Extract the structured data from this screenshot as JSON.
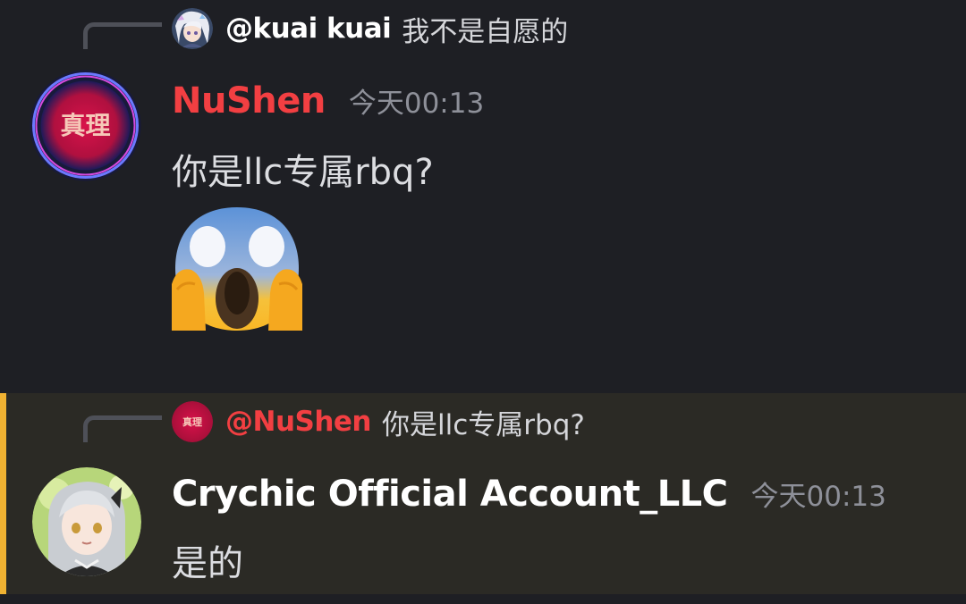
{
  "colors": {
    "background": "#1e1f24",
    "highlight_background": "#2b2a25",
    "mention_bar": "#f0b232",
    "nushen_name": "#f23f42",
    "crychic_name": "#ffffff",
    "reply_mention_nushen": "#f23f42",
    "timestamp": "#8e9099"
  },
  "messages": [
    {
      "reply": {
        "author": "@kuai kuai",
        "text": "我不是自愿的",
        "avatar_icon": "anime-avatar-icon"
      },
      "avatar_icon": "nushen-avatar-icon",
      "avatar_text": "真理",
      "username": "NuShen",
      "timestamp": "今天00:13",
      "content": "你是llc专属rbq?",
      "attachment_emoji": "face-screaming-in-fear-emoji"
    },
    {
      "reply": {
        "author": "@NuShen",
        "text": "你是llc专属rbq?",
        "avatar_icon": "nushen-avatar-icon",
        "avatar_text": "真理"
      },
      "avatar_icon": "crychic-avatar-icon",
      "username": "Crychic Official Account_LLC",
      "timestamp": "今天00:13",
      "content": "是的"
    }
  ]
}
